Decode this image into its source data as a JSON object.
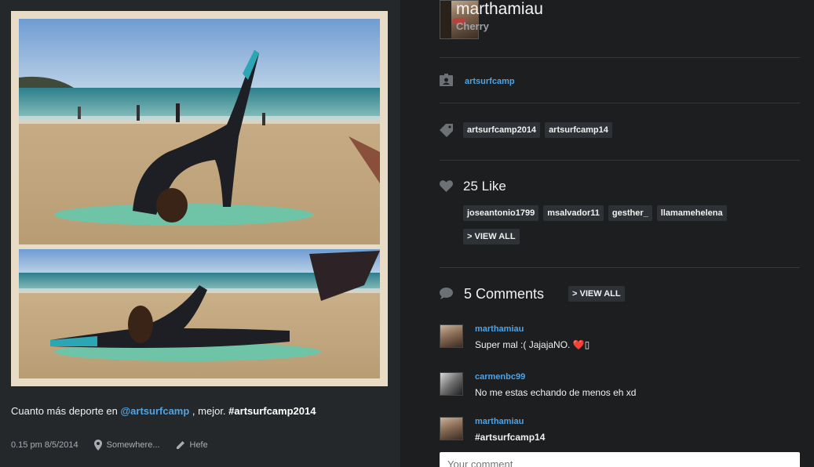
{
  "post": {
    "caption": {
      "prefix": "Cuanto más deporte en ",
      "mention": "@artsurfcamp",
      "middle": " , mejor. ",
      "hashtag": "#artsurfcamp2014"
    },
    "time": "0.15 pm 8/5/2014",
    "location": "Somewhere...",
    "filter": "Hefe"
  },
  "user": {
    "username": "marthamiau",
    "full_name": "Cherry"
  },
  "tagged_user": "artsurfcamp",
  "tags": [
    "artsurfcamp2014",
    "artsurfcamp14"
  ],
  "likes": {
    "count_label": "25 Like",
    "users": [
      "joseantonio1799",
      "msalvador11",
      "gesther_",
      "llamamehelena"
    ],
    "view_all": "> VIEW ALL"
  },
  "comments": {
    "count_label": "5 Comments",
    "view_all": "> VIEW ALL",
    "items": [
      {
        "user": "marthamiau",
        "text": "Super mal :( JajajaNO. ",
        "emoji": "❤️",
        "trail": "▯"
      },
      {
        "user": "carmenbc99",
        "text": "No me estas echando de menos eh xd"
      },
      {
        "user": "marthamiau",
        "text": "#artsurfcamp14"
      }
    ],
    "input_placeholder": "Your comment"
  },
  "colors": {
    "accent": "#4fa3e3",
    "left_panel_bg": "#25282b",
    "right_panel_bg": "#1c1e20",
    "pill_bg": "#2e3236"
  }
}
